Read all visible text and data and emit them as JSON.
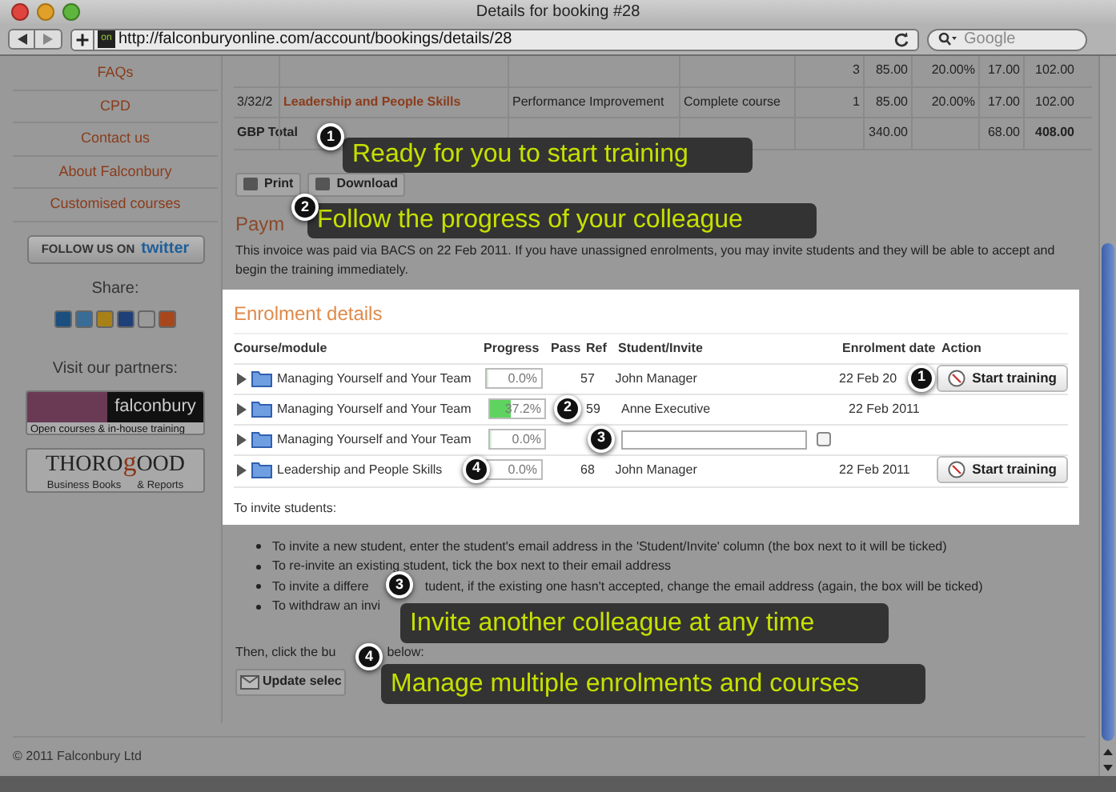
{
  "window": {
    "title": "Details for booking #28"
  },
  "toolbar": {
    "url": "http://falconburyonline.com/account/bookings/details/28",
    "search_placeholder": "Google",
    "site_badge": "on"
  },
  "sidebar": {
    "links": [
      "FAQs",
      "CPD",
      "Contact us",
      "About Falconbury",
      "Customised courses"
    ],
    "follow": {
      "prefix": "FOLLOW US ON",
      "brand": "twitter"
    },
    "share_label": "Share:",
    "partners_label": "Visit our partners:",
    "partners": [
      {
        "kind": "falconbury",
        "name": "falconbury",
        "tagline": "Open courses & in-house training"
      },
      {
        "kind": "thorogood",
        "name_parts": [
          "THORO",
          "g",
          "OOD"
        ],
        "tagline_parts": [
          "Business Books",
          "& Reports"
        ]
      }
    ]
  },
  "invoice": {
    "rows": [
      {
        "kind": "line",
        "cells": [
          "",
          "",
          "",
          "",
          "3",
          "85.00",
          "20.00%",
          "17.00",
          "102.00"
        ]
      },
      {
        "kind": "line",
        "cells": [
          "3/32/2",
          "Leadership and People Skills",
          "Performance Improvement",
          "Complete course",
          "1",
          "85.00",
          "20.00%",
          "17.00",
          "102.00"
        ]
      },
      {
        "kind": "total",
        "cells": [
          "GBP Total",
          "",
          "",
          "",
          "",
          "340.00",
          "",
          "68.00",
          "408.00"
        ]
      }
    ],
    "buttons": [
      "Print",
      "Download"
    ]
  },
  "payment": {
    "heading": "Paym",
    "text": "This invoice was paid via BACS on 22 Feb 2011. If you have unassigned enrolments, you may invite students and they will be able to accept and begin the training immediately."
  },
  "enrolment": {
    "title": "Enrolment details",
    "columns": [
      "Course/module",
      "Progress",
      "Pass",
      "Ref",
      "Student/Invite",
      "Enrolment date",
      "Action"
    ],
    "rows": [
      {
        "kind": "assigned",
        "course": "Managing Yourself and Your Team",
        "progress": "0.0%",
        "level": 0,
        "ref": "57",
        "student": "John Manager",
        "date": "22 Feb 20",
        "action": "Start training"
      },
      {
        "kind": "assigned",
        "course": "Managing Yourself and Your Team",
        "progress": "37.2%",
        "level": 0.372,
        "ref": "59",
        "student": "Anne Executive",
        "date": "22 Feb 2011"
      },
      {
        "kind": "invite",
        "course": "Managing Yourself and Your Team",
        "progress": "0.0%",
        "level": 0,
        "checked": false
      },
      {
        "kind": "assigned",
        "course": "Leadership and People Skills",
        "progress": "0.0%",
        "level": 0,
        "ref": "68",
        "student": "John Manager",
        "date": "22 Feb 2011",
        "action": "Start training"
      }
    ],
    "markers": [
      "1",
      "2",
      "3",
      "4"
    ],
    "intro": "To invite students:"
  },
  "instructions": {
    "bullets": [
      [
        "To invite a new student, enter the student's email address in the 'Student/Invite' column (the box next to it will be ticked)"
      ],
      [
        "To re-invite an existing student, tick the box next to their email address"
      ],
      [
        "To invite a differe",
        "tudent, if the existing one hasn't accepted, change the email address (again, the box will be ticked)"
      ],
      [
        "To withdraw an invi"
      ]
    ],
    "then": [
      "Then, click the bu",
      "below:"
    ],
    "update_button": "Update selec"
  },
  "callouts": [
    {
      "number": "1",
      "text": "Ready for you to start training"
    },
    {
      "number": "2",
      "text": "Follow the progress of your colleague"
    },
    {
      "number": "3",
      "text": "Invite another colleague at any time"
    },
    {
      "number": "4",
      "text": "Manage multiple enrolments and courses"
    }
  ],
  "footer": "© 2011 Falconbury Ltd"
}
